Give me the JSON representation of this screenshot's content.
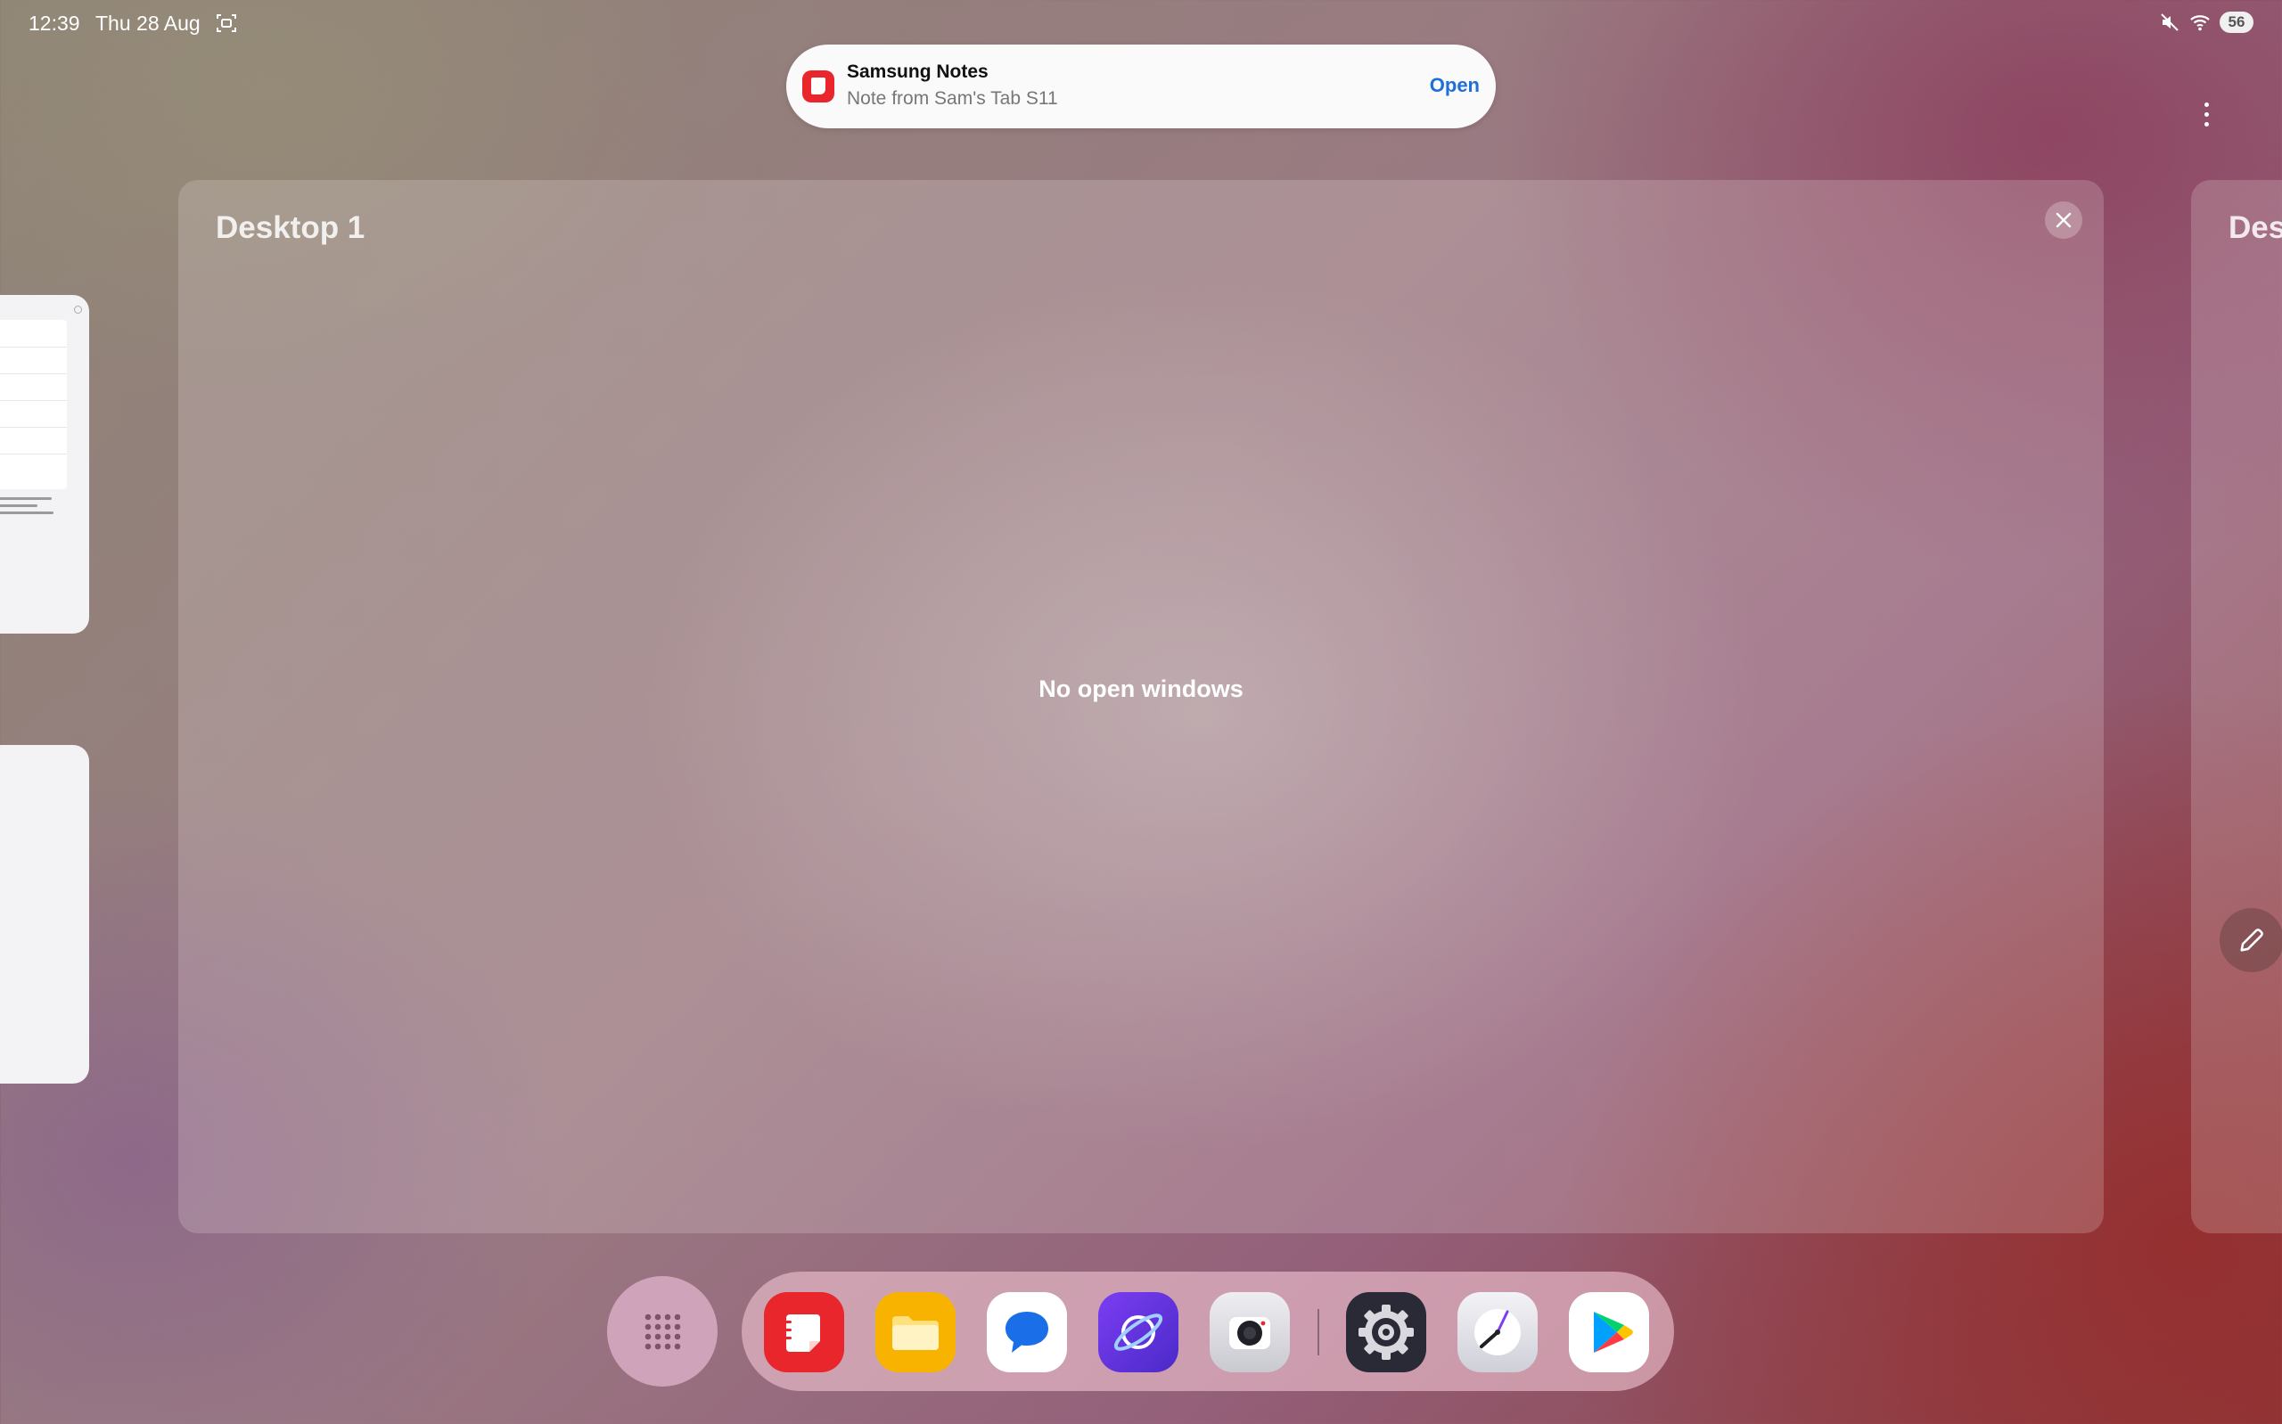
{
  "status_bar": {
    "time": "12:39",
    "date": "Thu 28 Aug",
    "battery": "56",
    "icons": [
      "screenshot-icon",
      "mute-icon",
      "wifi-icon",
      "battery-icon"
    ]
  },
  "notification": {
    "app_name": "Samsung Notes",
    "text": "Note from Sam's Tab S11",
    "action": "Open",
    "accent": "#1f6fd6",
    "icon": "samsung-notes-icon"
  },
  "desktops": [
    {
      "title": "Desktop 1",
      "empty_message": "No open windows"
    },
    {
      "title": "Des"
    }
  ],
  "dock": {
    "apps_button_icon": "app-drawer-icon",
    "apps": [
      {
        "name": "Samsung Notes",
        "icon": "samsung-notes-icon",
        "color": "#e8262b"
      },
      {
        "name": "My Files",
        "icon": "folder-icon",
        "color": "#f7b300"
      },
      {
        "name": "Messages",
        "icon": "messages-icon",
        "color": "#ffffff"
      },
      {
        "name": "Internet",
        "icon": "internet-icon",
        "color": "#6a3df0"
      },
      {
        "name": "Camera",
        "icon": "camera-icon",
        "color": "#d9d9de"
      },
      {
        "name": "Settings",
        "icon": "settings-icon",
        "color": "#2a2a36"
      },
      {
        "name": "Clock",
        "icon": "clock-icon",
        "color": "#e6e6ec"
      },
      {
        "name": "Play Store",
        "icon": "play-store-icon",
        "color": "#ffffff"
      }
    ]
  }
}
